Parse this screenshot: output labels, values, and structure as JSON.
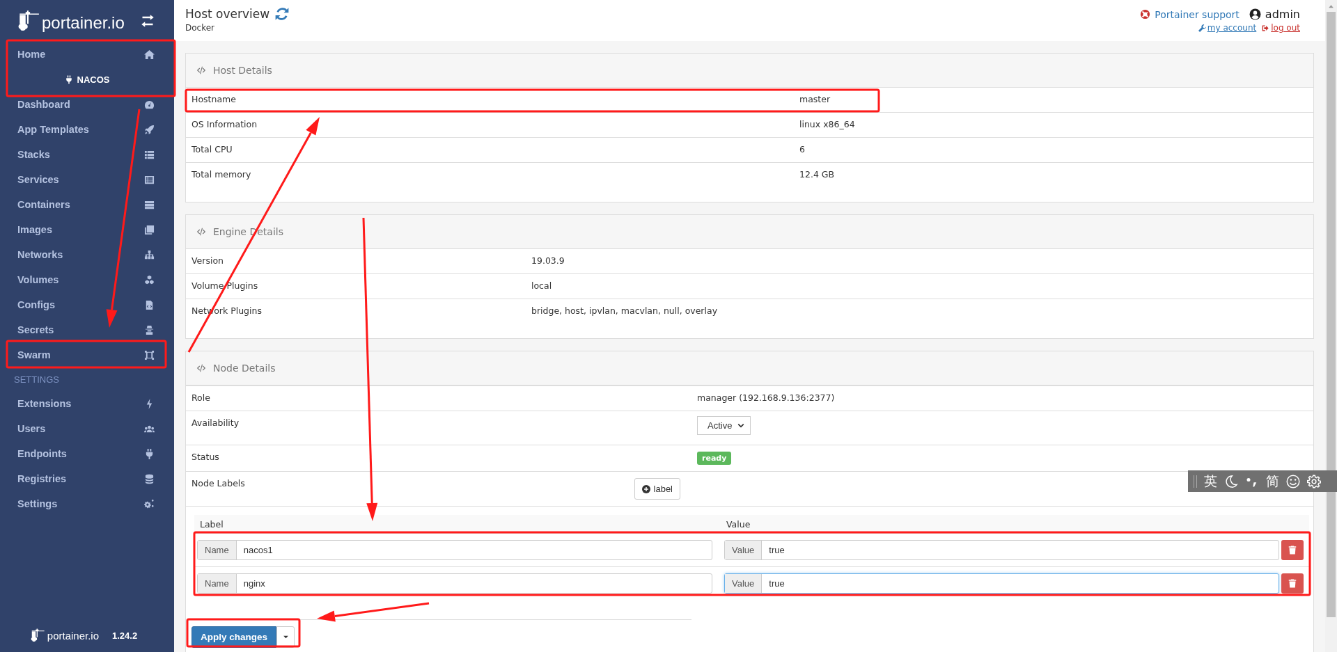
{
  "sidebar": {
    "brand": "portainer.io",
    "endpoint": "NACOS",
    "items": [
      {
        "label": "Home"
      },
      {
        "label": "Dashboard"
      },
      {
        "label": "App Templates"
      },
      {
        "label": "Stacks"
      },
      {
        "label": "Services"
      },
      {
        "label": "Containers"
      },
      {
        "label": "Images"
      },
      {
        "label": "Networks"
      },
      {
        "label": "Volumes"
      },
      {
        "label": "Configs"
      },
      {
        "label": "Secrets"
      },
      {
        "label": "Swarm"
      }
    ],
    "settings_heading": "SETTINGS",
    "settings_items": [
      {
        "label": "Extensions"
      },
      {
        "label": "Users"
      },
      {
        "label": "Endpoints"
      },
      {
        "label": "Registries"
      },
      {
        "label": "Settings"
      }
    ],
    "footer": {
      "brand": "portainer.io",
      "version": "1.24.2"
    }
  },
  "header": {
    "title": "Host overview",
    "subtitle": "Docker",
    "support": "Portainer support",
    "user": "admin",
    "my_account": "my account",
    "log_out": "log out"
  },
  "panels": [
    {
      "title": "Host Details",
      "rows": [
        {
          "label": "Hostname",
          "value": "master"
        },
        {
          "label": "OS Information",
          "value": "linux x86_64"
        },
        {
          "label": "Total CPU",
          "value": "6"
        },
        {
          "label": "Total memory",
          "value": "12.4 GB"
        }
      ]
    },
    {
      "title": "Engine Details",
      "rows": [
        {
          "label": "Version",
          "value": "19.03.9"
        },
        {
          "label": "Volume Plugins",
          "value": "local"
        },
        {
          "label": "Network Plugins",
          "value": "bridge, host, ipvlan, macvlan, null, overlay"
        }
      ]
    }
  ],
  "node_details": {
    "title": "Node Details",
    "role_label": "Role",
    "role": "manager (192.168.9.136:2377)",
    "availability_label": "Availability",
    "availability": "Active",
    "status_label": "Status",
    "status": "ready",
    "labels_label": "Node Labels",
    "add_label": "label",
    "label_columns": [
      "Label",
      "Value"
    ],
    "labels": [
      {
        "name_addon": "Name",
        "name": "nacos1",
        "value_addon": "Value",
        "value": "true",
        "focused": false
      },
      {
        "name_addon": "Name",
        "name": "nginx",
        "value_addon": "Value",
        "value": "true",
        "focused": true
      }
    ],
    "apply": "Apply changes"
  },
  "ime_toolbar": {
    "mode": "英",
    "script": "简"
  },
  "annotations": [
    {
      "kind": "box"
    },
    {
      "kind": "box"
    },
    {
      "kind": "box"
    },
    {
      "kind": "box"
    },
    {
      "kind": "box"
    },
    {
      "kind": "arrow"
    },
    {
      "kind": "arrow"
    },
    {
      "kind": "arrow"
    },
    {
      "kind": "arrow"
    }
  ]
}
